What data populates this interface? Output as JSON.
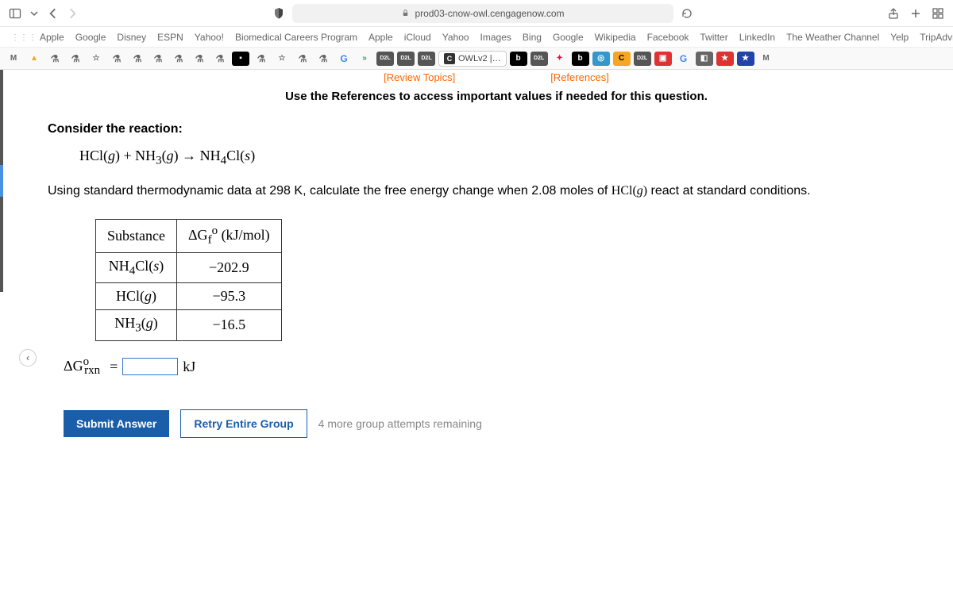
{
  "browser": {
    "url": "prod03-cnow-owl.cengagenow.com",
    "bookmarks": [
      "Apple",
      "Google",
      "Disney",
      "ESPN",
      "Yahoo!",
      "Biomedical Careers Program",
      "Apple",
      "iCloud",
      "Yahoo",
      "Images",
      "Bing",
      "Google",
      "Wikipedia",
      "Facebook",
      "Twitter",
      "LinkedIn",
      "The Weather Channel",
      "Yelp",
      "TripAdvisor"
    ],
    "active_tab_label": "OWLv2 |…"
  },
  "links": {
    "review": "[Review Topics]",
    "references": "[References]"
  },
  "instruction": "Use the References to access important values if needed for this question.",
  "question": {
    "lead": "Consider the reaction:",
    "equation_text": "HCl(g) + NH3(g) → NH4Cl(s)",
    "body_before": "Using standard thermodynamic data at 298 K, calculate the free energy change when 2.08 moles of ",
    "body_species": "HCl(g)",
    "body_after": " react at standard conditions."
  },
  "table": {
    "headers": {
      "substance": "Substance",
      "gf_label": "ΔG",
      "gf_unit": "(kJ/mol)"
    },
    "rows": [
      {
        "substance": "NH4Cl(s)",
        "value": "−202.9"
      },
      {
        "substance": "HCl(g)",
        "value": "−95.3"
      },
      {
        "substance": "NH3(g)",
        "value": "−16.5"
      }
    ]
  },
  "answer": {
    "label_prefix": "ΔG",
    "label_sub": "rxn",
    "equals": "=",
    "unit": "kJ"
  },
  "buttons": {
    "submit": "Submit Answer",
    "retry": "Retry Entire Group",
    "attempts": "4 more group attempts remaining"
  },
  "tab_badges": [
    "D2L",
    "D2L",
    "D2L",
    "D2L",
    "D2L"
  ]
}
